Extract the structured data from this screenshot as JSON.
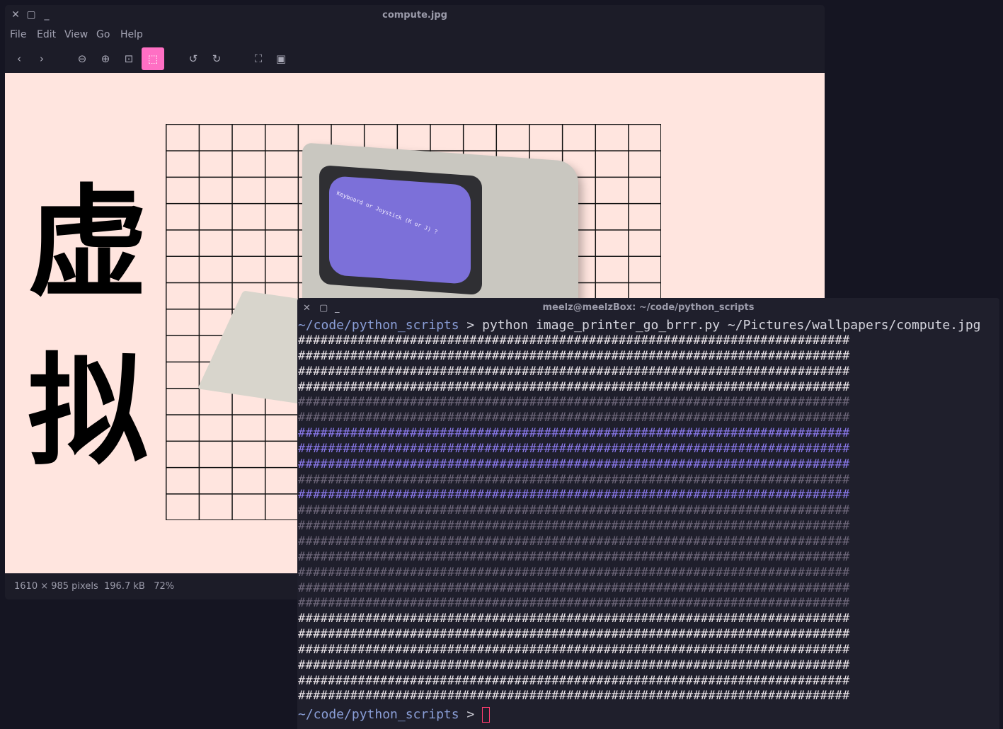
{
  "viewer": {
    "title": "compute.jpg",
    "menu": [
      "File",
      "Edit",
      "View",
      "Go",
      "Help"
    ],
    "toolbar_icons": [
      "back-icon",
      "forward-icon",
      "zoom-out-icon",
      "zoom-in-icon",
      "zoom-original-icon",
      "fit-best-icon",
      "rotate-left-icon",
      "rotate-right-icon",
      "fullscreen-icon",
      "slideshow-icon"
    ],
    "image": {
      "kanji_top": "虚",
      "kanji_bottom": "拟",
      "screen_text": "Keyboard or Joystick (K or J) ?"
    },
    "status": {
      "dimensions": "1610 × 985 pixels",
      "size": "196.7 kB",
      "zoom": "72%"
    }
  },
  "terminal": {
    "title": "meelz@meelzBox: ~/code/python_scripts",
    "prompt_path": "~/code/python_scripts",
    "prompt_symbol": ">",
    "command": "python image_printer_go_brrr.py ~/Pictures/wallpapers/compute.jpg",
    "ascii_row": "##########################################################################"
  },
  "colors": {
    "accent": "#ff6fc4",
    "canvas_bg": "#ffe5df",
    "prompt": "#8a9ed7",
    "cursor": "#ff3c6e"
  }
}
